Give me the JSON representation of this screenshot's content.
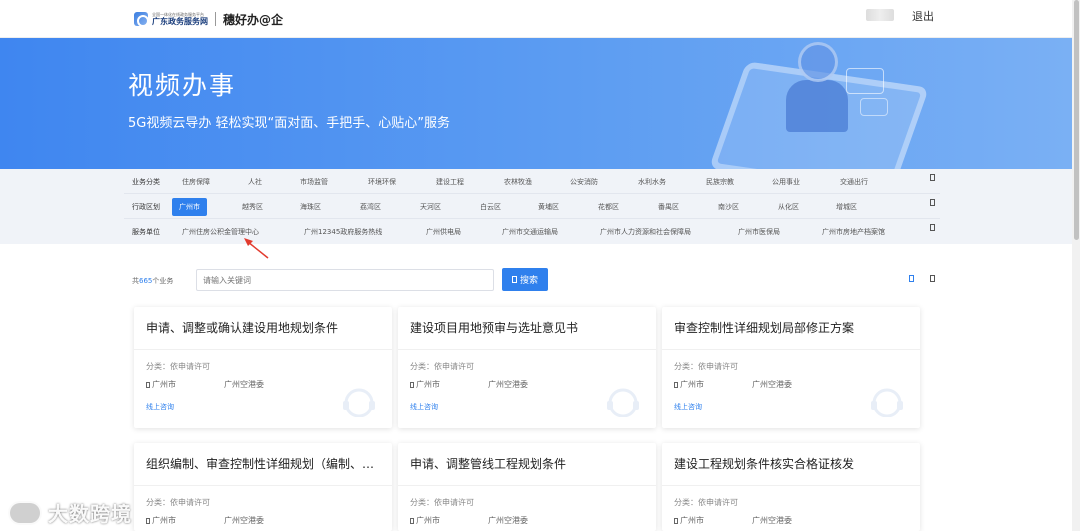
{
  "header": {
    "logo_small": "全国一体化在线政务服务平台",
    "logo_main": "广东政务服务网",
    "logo_sub": "穗好办@企",
    "logout": "退出"
  },
  "banner": {
    "title": "视频办事",
    "subtitle": "5G视频云导办 轻松实现“面对面、手把手、心贴心”服务"
  },
  "filters": {
    "category": {
      "label": "业务分类",
      "items": [
        "住房保障",
        "人社",
        "市场监管",
        "环境环保",
        "建设工程",
        "农林牧渔",
        "公安消防",
        "水利水务",
        "民族宗教",
        "公用事业",
        "交通出行"
      ]
    },
    "district": {
      "label": "行政区划",
      "active": "广州市",
      "items": [
        "越秀区",
        "海珠区",
        "荔湾区",
        "天河区",
        "白云区",
        "黄埔区",
        "花都区",
        "番禺区",
        "南沙区",
        "从化区",
        "增城区"
      ]
    },
    "unit": {
      "label": "服务单位",
      "items": [
        "广州住房公积金管理中心",
        "广州12345政府服务热线",
        "广州供电局",
        "广州市交通运输局",
        "广州市人力资源和社会保障局",
        "广州市医保局",
        "广州市房地产档案馆"
      ]
    }
  },
  "search": {
    "count_prefix": "共",
    "count_num": "665",
    "count_suffix": "个业务",
    "placeholder": "请输入关键词",
    "button": "搜索"
  },
  "cards": [
    {
      "title": "申请、调整或确认建设用地规划条件",
      "category": "分类：依申请许可",
      "location": "广州市",
      "org": "广州空港委",
      "link": "线上咨询"
    },
    {
      "title": "建设项目用地预审与选址意见书",
      "category": "分类：依申请许可",
      "location": "广州市",
      "org": "广州空港委",
      "link": "线上咨询"
    },
    {
      "title": "审查控制性详细规划局部修正方案",
      "category": "分类：依申请许可",
      "location": "广州市",
      "org": "广州空港委",
      "link": "线上咨询"
    },
    {
      "title": "组织编制、审查控制性详细规划（编制、…",
      "category": "分类：依申请许可",
      "location": "广州市",
      "org": "广州空港委",
      "link": ""
    },
    {
      "title": "申请、调整管线工程规划条件",
      "category": "分类：依申请许可",
      "location": "广州市",
      "org": "广州空港委",
      "link": ""
    },
    {
      "title": "建设工程规划条件核实合格证核发",
      "category": "分类：依申请许可",
      "location": "广州市",
      "org": "广州空港委",
      "link": ""
    }
  ],
  "watermark": "大数跨境"
}
